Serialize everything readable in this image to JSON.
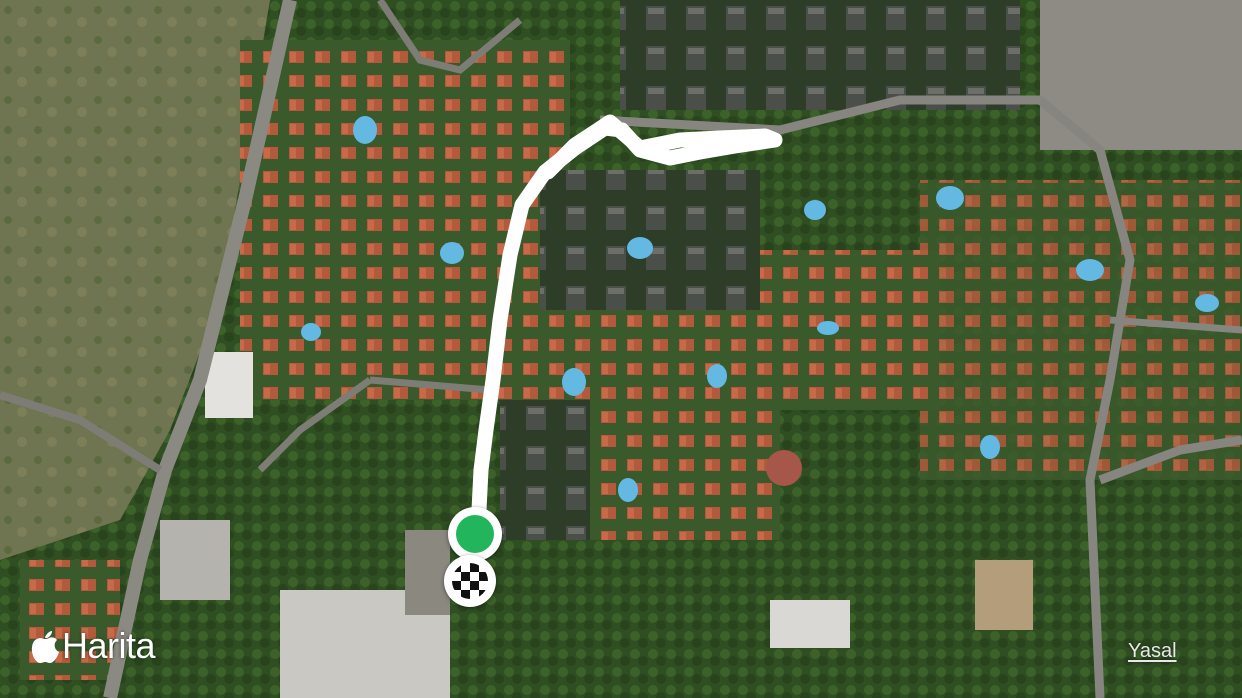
{
  "map": {
    "type": "satellite",
    "brand_name": "Harita",
    "legal_link": "Yasal",
    "route_color": "#ffffff",
    "start_color": "#22b55c",
    "icons": {
      "brand": "apple-logo-icon",
      "start": "start-pin-icon",
      "finish": "checkered-flag-icon"
    }
  }
}
